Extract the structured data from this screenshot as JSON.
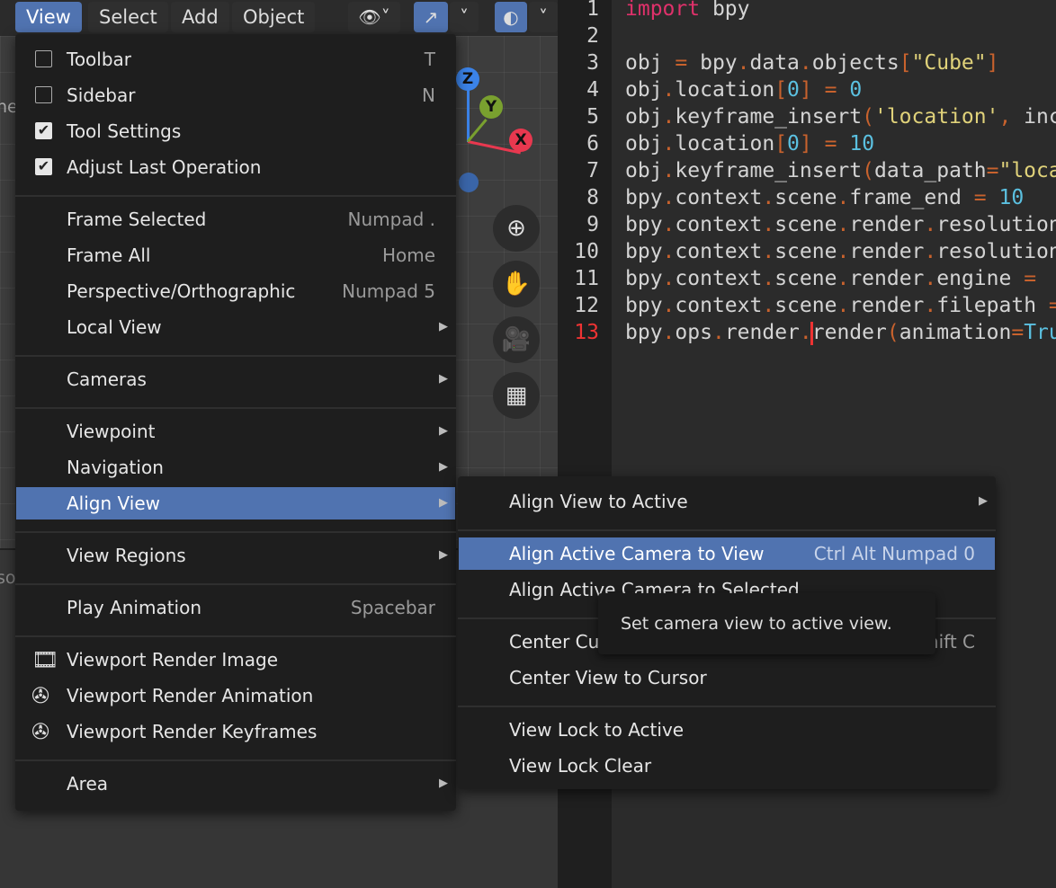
{
  "header": {
    "menus": [
      "View",
      "Select",
      "Add",
      "Object"
    ],
    "active_menu": "View"
  },
  "viewport": {
    "object_label": "nera",
    "lower_label": "sole",
    "gizmo_axes": [
      "Z",
      "Y",
      "X"
    ],
    "axis_colors": {
      "Z": "#3b83e8",
      "Y": "#79a02f",
      "X": "#e8384f"
    }
  },
  "editor": {
    "line_numbers": [
      "1",
      "2",
      "3",
      "4",
      "5",
      "6",
      "7",
      "8",
      "9",
      "10",
      "11",
      "12",
      "13"
    ],
    "current_line": "13",
    "lines": [
      [
        [
          "import",
          "kw"
        ],
        [
          " bpy",
          ""
        ]
      ],
      [],
      [
        [
          "obj ",
          ""
        ],
        [
          "=",
          "p"
        ],
        [
          " bpy",
          ""
        ],
        [
          ".",
          "p"
        ],
        [
          "data",
          ""
        ],
        [
          ".",
          "p"
        ],
        [
          "objects",
          ""
        ],
        [
          "[",
          "p"
        ],
        [
          "\"Cube\"",
          "s"
        ],
        [
          "]",
          "p"
        ]
      ],
      [
        [
          "obj",
          ""
        ],
        [
          ".",
          "p"
        ],
        [
          "location",
          ""
        ],
        [
          "[",
          "p"
        ],
        [
          "0",
          "n"
        ],
        [
          "]",
          "p"
        ],
        [
          " ",
          ""
        ],
        [
          "=",
          "p"
        ],
        [
          " ",
          ""
        ],
        [
          "0",
          "n"
        ]
      ],
      [
        [
          "obj",
          ""
        ],
        [
          ".",
          "p"
        ],
        [
          "keyframe_insert",
          ""
        ],
        [
          "(",
          "p"
        ],
        [
          "'location'",
          "s"
        ],
        [
          ",",
          "p"
        ],
        [
          " inc",
          ""
        ]
      ],
      [
        [
          "obj",
          ""
        ],
        [
          ".",
          "p"
        ],
        [
          "location",
          ""
        ],
        [
          "[",
          "p"
        ],
        [
          "0",
          "n"
        ],
        [
          "]",
          "p"
        ],
        [
          " ",
          ""
        ],
        [
          "=",
          "p"
        ],
        [
          " ",
          ""
        ],
        [
          "10",
          "n"
        ]
      ],
      [
        [
          "obj",
          ""
        ],
        [
          ".",
          "p"
        ],
        [
          "keyframe_insert",
          ""
        ],
        [
          "(",
          "p"
        ],
        [
          "data_path",
          ""
        ],
        [
          "=",
          "p"
        ],
        [
          "\"loca",
          "s"
        ]
      ],
      [
        [
          "bpy",
          ""
        ],
        [
          ".",
          "p"
        ],
        [
          "context",
          ""
        ],
        [
          ".",
          "p"
        ],
        [
          "scene",
          ""
        ],
        [
          ".",
          "p"
        ],
        [
          "frame_end ",
          ""
        ],
        [
          "=",
          "p"
        ],
        [
          " ",
          ""
        ],
        [
          "10",
          "n"
        ]
      ],
      [
        [
          "bpy",
          ""
        ],
        [
          ".",
          "p"
        ],
        [
          "context",
          ""
        ],
        [
          ".",
          "p"
        ],
        [
          "scene",
          ""
        ],
        [
          ".",
          "p"
        ],
        [
          "render",
          ""
        ],
        [
          ".",
          "p"
        ],
        [
          "resolution",
          ""
        ]
      ],
      [
        [
          "bpy",
          ""
        ],
        [
          ".",
          "p"
        ],
        [
          "context",
          ""
        ],
        [
          ".",
          "p"
        ],
        [
          "scene",
          ""
        ],
        [
          ".",
          "p"
        ],
        [
          "render",
          ""
        ],
        [
          ".",
          "p"
        ],
        [
          "resolution",
          ""
        ]
      ],
      [
        [
          "bpy",
          ""
        ],
        [
          ".",
          "p"
        ],
        [
          "context",
          ""
        ],
        [
          ".",
          "p"
        ],
        [
          "scene",
          ""
        ],
        [
          ".",
          "p"
        ],
        [
          "render",
          ""
        ],
        [
          ".",
          "p"
        ],
        [
          "engine ",
          ""
        ],
        [
          "=",
          "p"
        ]
      ],
      [
        [
          "bpy",
          ""
        ],
        [
          ".",
          "p"
        ],
        [
          "context",
          ""
        ],
        [
          ".",
          "p"
        ],
        [
          "scene",
          ""
        ],
        [
          ".",
          "p"
        ],
        [
          "render",
          ""
        ],
        [
          ".",
          "p"
        ],
        [
          "filepath ",
          ""
        ],
        [
          "=",
          "p"
        ]
      ],
      [
        [
          "bpy",
          ""
        ],
        [
          ".",
          "p"
        ],
        [
          "ops",
          ""
        ],
        [
          ".",
          "p"
        ],
        [
          "render",
          ""
        ],
        [
          ".",
          "p"
        ],
        [
          "|",
          ""
        ],
        [
          "render",
          ""
        ],
        [
          "(",
          "p"
        ],
        [
          "animation",
          ""
        ],
        [
          "=",
          "p"
        ],
        [
          "Tru",
          "n"
        ]
      ]
    ]
  },
  "view_menu": {
    "items": [
      {
        "label": "Toolbar",
        "shortcut": "T",
        "check": false,
        "y": 0
      },
      {
        "label": "Sidebar",
        "shortcut": "N",
        "check": false
      },
      {
        "label": "Tool Settings",
        "check": true
      },
      {
        "label": "Adjust Last Operation",
        "check": true
      },
      {
        "sep": true
      },
      {
        "label": "Frame Selected",
        "shortcut": "Numpad ."
      },
      {
        "label": "Frame All",
        "shortcut": "Home"
      },
      {
        "label": "Perspective/Orthographic",
        "shortcut": "Numpad 5"
      },
      {
        "label": "Local View",
        "submenu": true
      },
      {
        "sep": true
      },
      {
        "label": "Cameras",
        "submenu": true
      },
      {
        "sep": true
      },
      {
        "label": "Viewpoint",
        "submenu": true
      },
      {
        "label": "Navigation",
        "submenu": true
      },
      {
        "label": "Align View",
        "submenu": true,
        "highlighted": true
      },
      {
        "sep": true
      },
      {
        "label": "View Regions",
        "submenu": true
      },
      {
        "sep": true
      },
      {
        "label": "Play Animation",
        "shortcut": "Spacebar"
      },
      {
        "sep": true
      },
      {
        "label": "Viewport Render Image",
        "icon": "render-image-icon"
      },
      {
        "label": "Viewport Render Animation",
        "icon": "render-animation-icon"
      },
      {
        "label": "Viewport Render Keyframes",
        "icon": "render-keyframes-icon"
      },
      {
        "sep": true
      },
      {
        "label": "Area",
        "submenu": true
      }
    ]
  },
  "align_view_menu": {
    "items": [
      {
        "label": "Align View to Active",
        "submenu": true
      },
      {
        "sep": true
      },
      {
        "label": "Align Active Camera to View",
        "shortcut": "Ctrl Alt Numpad 0",
        "highlighted": true
      },
      {
        "label": "Align Active Camera to Selected"
      },
      {
        "sep": true
      },
      {
        "label": "Center Cursor and View All",
        "shortcut": "Shift C"
      },
      {
        "label": "Center View to Cursor"
      },
      {
        "sep": true
      },
      {
        "label": "View Lock to Active"
      },
      {
        "label": "View Lock Clear"
      }
    ]
  },
  "tooltip": {
    "text": "Set camera view to active view."
  },
  "colors": {
    "accent": "#5073b0",
    "menu_bg": "#1e1e1e",
    "editor_bg": "#2b2b2b",
    "keyword": "#e0316b",
    "string": "#e0d27a",
    "number": "#5bc0e0",
    "punct": "#c8622d"
  }
}
